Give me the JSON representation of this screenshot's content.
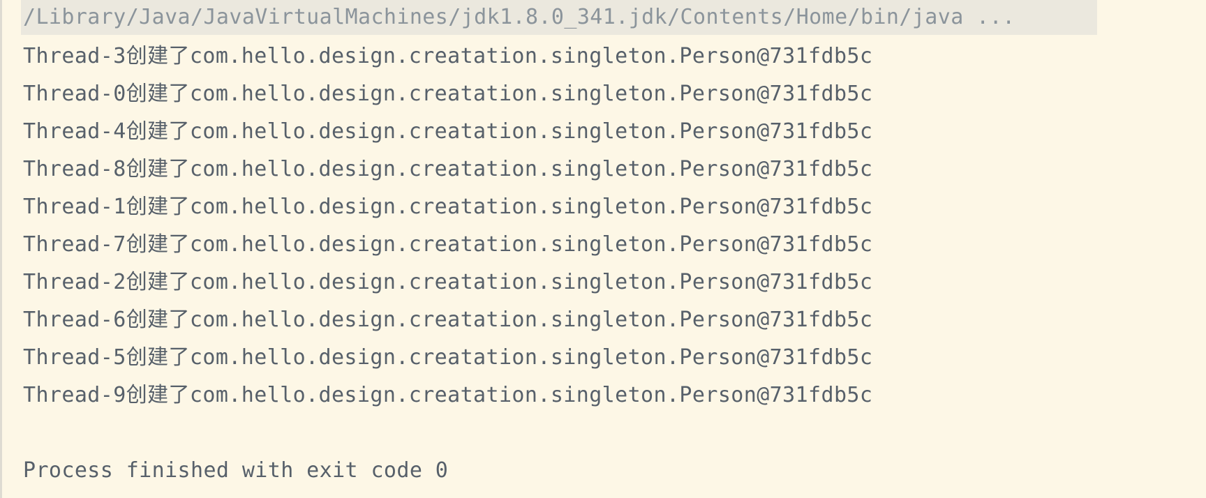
{
  "console": {
    "command": "/Library/Java/JavaVirtualMachines/jdk1.8.0_341.jdk/Contents/Home/bin/java ...",
    "output_lines": [
      "Thread-3创建了com.hello.design.creatation.singleton.Person@731fdb5c",
      "Thread-0创建了com.hello.design.creatation.singleton.Person@731fdb5c",
      "Thread-4创建了com.hello.design.creatation.singleton.Person@731fdb5c",
      "Thread-8创建了com.hello.design.creatation.singleton.Person@731fdb5c",
      "Thread-1创建了com.hello.design.creatation.singleton.Person@731fdb5c",
      "Thread-7创建了com.hello.design.creatation.singleton.Person@731fdb5c",
      "Thread-2创建了com.hello.design.creatation.singleton.Person@731fdb5c",
      "Thread-6创建了com.hello.design.creatation.singleton.Person@731fdb5c",
      "Thread-5创建了com.hello.design.creatation.singleton.Person@731fdb5c",
      "Thread-9创建了com.hello.design.creatation.singleton.Person@731fdb5c"
    ],
    "exit_message": "Process finished with exit code 0"
  },
  "colors": {
    "background": "#fdf7e6",
    "command_highlight": "#ebe8de",
    "command_text": "#8b949b",
    "output_text": "#57606a"
  }
}
